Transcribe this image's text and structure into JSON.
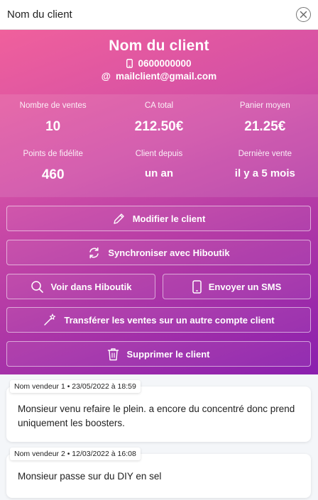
{
  "window": {
    "title": "Nom du client"
  },
  "client": {
    "name": "Nom du client",
    "phone": "0600000000",
    "email_prefix": "@",
    "email": "mailclient@gmail.com"
  },
  "stats": {
    "sales_count": {
      "label": "Nombre de ventes",
      "value": "10"
    },
    "ca_total": {
      "label": "CA total",
      "value": "212.50€"
    },
    "avg_basket": {
      "label": "Panier moyen",
      "value": "21.25€"
    },
    "loyalty_points": {
      "label": "Points de fidélite",
      "value": "460"
    },
    "client_since": {
      "label": "Client depuis",
      "value": "un an"
    },
    "last_sale": {
      "label": "Dernière vente",
      "value": "il y a 5 mois"
    }
  },
  "actions": {
    "edit": "Modifier le client",
    "sync": "Synchroniser avec Hiboutik",
    "view": "Voir dans Hiboutik",
    "sms": "Envoyer un SMS",
    "transfer": "Transférer les ventes sur un autre compte client",
    "delete": "Supprimer le client"
  },
  "notes": [
    {
      "tag": "Nom vendeur 1 • 23/05/2022 à 18:59",
      "text": "Monsieur venu refaire le plein. a encore du concentré donc prend uniquement les boosters."
    },
    {
      "tag": "Nom vendeur 2 • 12/03/2022 à 16:08",
      "text": "Monsieur passe sur du DIY en sel"
    }
  ],
  "icons": {
    "close": "close-icon",
    "phone": "phone-icon",
    "pencil": "pencil-icon",
    "sync": "sync-icon",
    "search": "search-icon",
    "trash": "trash-icon",
    "wand": "magic-wand-icon"
  }
}
